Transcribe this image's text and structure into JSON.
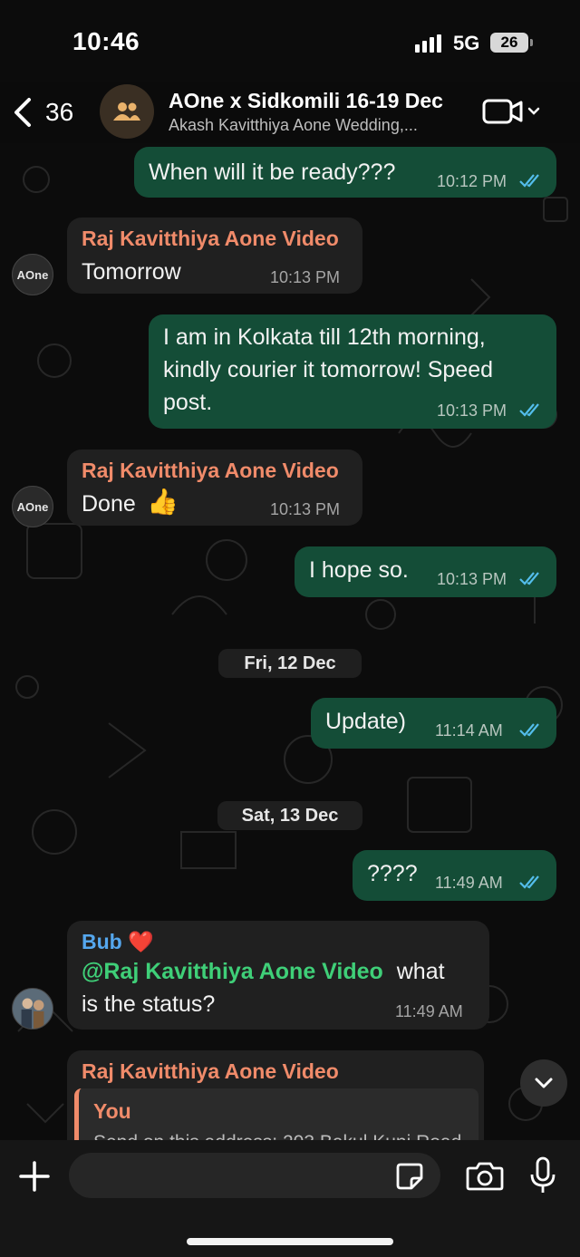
{
  "status_bar": {
    "time": "10:46",
    "network": "5G",
    "battery": "26"
  },
  "header": {
    "back_count": "36",
    "title": "AOne x Sidkomili 16-19 Dec",
    "subtitle": "Akash Kavitthiya Aone Wedding,..."
  },
  "messages": [
    {
      "dir": "out",
      "text": "When will it be ready???",
      "time": "10:12 PM",
      "status": "read"
    },
    {
      "dir": "in",
      "sender": "Raj Kavitthiya Aone Video",
      "text": "Tomorrow",
      "time": "10:13 PM"
    },
    {
      "dir": "out",
      "text_lines": [
        "I am in Kolkata till 12th morning,",
        "kindly courier it tomorrow! Speed",
        "post."
      ],
      "time": "10:13 PM",
      "status": "read"
    },
    {
      "dir": "in",
      "sender": "Raj Kavitthiya Aone Video",
      "text": "Done",
      "emoji": "👍",
      "time": "10:13 PM"
    },
    {
      "dir": "out",
      "text": "I hope so.",
      "time": "10:13 PM",
      "status": "read"
    },
    {
      "type": "date",
      "text": "Fri, 12 Dec"
    },
    {
      "dir": "out",
      "text": "Update)",
      "time": "11:14 AM",
      "status": "read"
    },
    {
      "type": "date",
      "text": "Sat, 13 Dec"
    },
    {
      "dir": "out",
      "text": "????",
      "time": "11:49 AM",
      "status": "read"
    },
    {
      "dir": "in",
      "sender": "Bub",
      "sender_emoji": "❤️",
      "mention": "@Raj Kavitthiya Aone Video",
      "text_after_mention": "what",
      "text_line2": "is the status?",
      "time": "11:49 AM"
    },
    {
      "dir": "in",
      "sender": "Raj Kavitthiya Aone Video",
      "quote": {
        "name": "You",
        "preview": "Send on this address: 203 Bakul Kunj Road"
      }
    }
  ],
  "avatars": {
    "raj": "AOne"
  },
  "composer": {
    "placeholder": ""
  },
  "colors": {
    "outgoing_bubble": "#144d37",
    "incoming_bubble": "#202020",
    "sender_name": "#f08b6a",
    "bub_name": "#55a7ee",
    "mention": "#3fcf78",
    "read_ticks": "#53bdeb"
  },
  "icons": [
    "back-chevron-icon",
    "group-icon",
    "video-call-icon",
    "chevron-down-icon",
    "plus-icon",
    "sticker-icon",
    "camera-icon",
    "mic-icon",
    "double-check-icon"
  ]
}
